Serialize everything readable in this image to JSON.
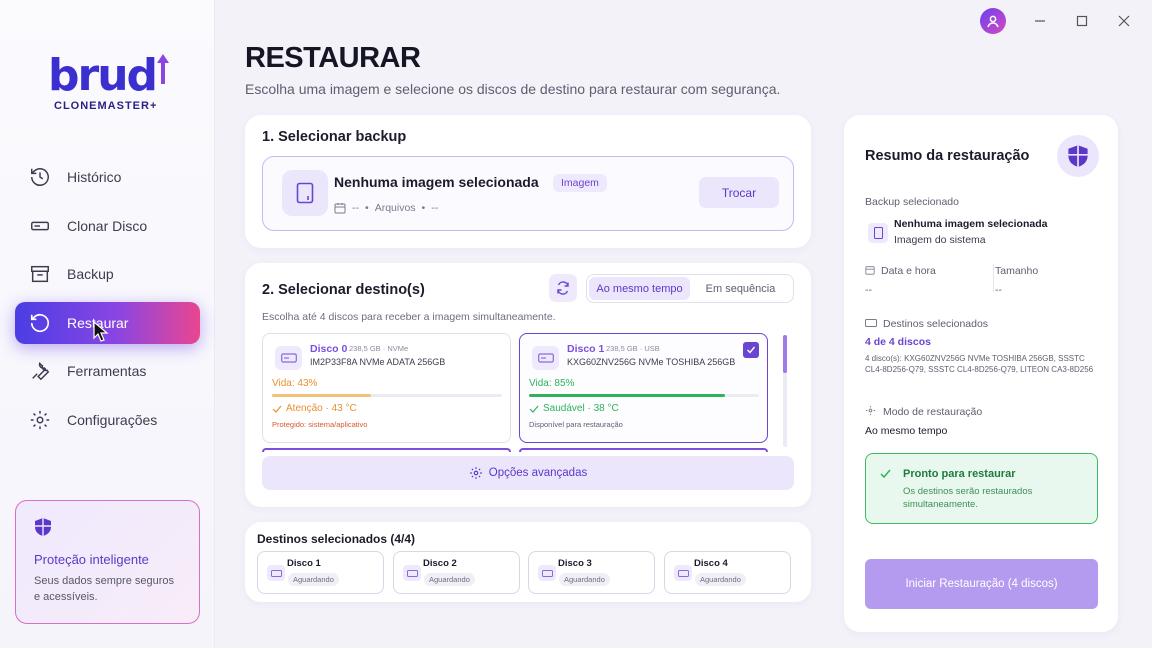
{
  "brand": {
    "logo_text": "brud",
    "tagline": "CLONEMASTER+"
  },
  "nav": {
    "items": [
      {
        "label": "Histórico"
      },
      {
        "label": "Clonar Disco"
      },
      {
        "label": "Backup"
      },
      {
        "label": "Restaurar"
      },
      {
        "label": "Ferramentas"
      },
      {
        "label": "Configurações"
      }
    ]
  },
  "promo": {
    "title": "Proteção inteligente",
    "text": "Seus dados sempre seguros e acessíveis."
  },
  "page": {
    "title": "RESTAURAR",
    "subtitle": "Escolha uma imagem e selecione os discos de destino para restaurar com segurança."
  },
  "step1": {
    "title": "1. Selecionar backup",
    "image_name": "Nenhuma imagem selecionada",
    "tag": "Imagem",
    "meta_date": "--",
    "meta_files": "Arquivos",
    "meta_size": "--",
    "change_button": "Trocar"
  },
  "step2": {
    "title": "2. Selecionar destino(s)",
    "mode_options": [
      "Ao mesmo tempo",
      "Em sequência"
    ],
    "hint": "Escolha até 4 discos para receber a imagem simultaneamente.",
    "disks": [
      {
        "name": "Disco 0",
        "spec": "238,5 GB · NVMe",
        "model": "IM2P33F8A NVMe ADATA 256GB",
        "life": "Vida: 43%",
        "life_pct": 43,
        "status": "Atenção · 43 °C",
        "note": "Protegido: sistema/aplicativo",
        "color": "#e8902e"
      },
      {
        "name": "Disco 1",
        "spec": "238,5 GB · USB",
        "model": "KXG60ZNV256G NVMe TOSHIBA 256GB",
        "life": "Vida: 85%",
        "life_pct": 85,
        "status": "Saudável · 38 °C",
        "note": "Disponível para restauração",
        "color": "#2fb35a"
      }
    ],
    "advanced": "Opções avançadas"
  },
  "destinations": {
    "title": "Destinos selecionados (4/4)",
    "items": [
      {
        "name": "Disco 1",
        "status": "Aguardando"
      },
      {
        "name": "Disco 2",
        "status": "Aguardando"
      },
      {
        "name": "Disco 3",
        "status": "Aguardando"
      },
      {
        "name": "Disco 4",
        "status": "Aguardando"
      }
    ]
  },
  "summary": {
    "title": "Resumo da restauração",
    "backup_label": "Backup selecionado",
    "backup_name": "Nenhuma imagem selecionada",
    "backup_type": "Imagem do sistema",
    "date_label": "Data e hora",
    "date_value": "--",
    "size_label": "Tamanho",
    "size_value": "--",
    "dest_label": "Destinos selecionados",
    "dest_count": "4 de 4 discos",
    "dest_list": "4 disco(s): KXG60ZNV256G NVMe TOSHIBA 256GB, SSSTC CL4-8D256-Q79, SSSTC CL4-8D256-Q79, LITEON CA3-8D256",
    "mode_label": "Modo de restauração",
    "mode_value": "Ao mesmo tempo",
    "ready_title": "Pronto para restaurar",
    "ready_text": "Os destinos serão restaurados simultaneamente.",
    "start_button": "Iniciar Restauração (4 discos)"
  },
  "colors": {
    "accent": "#6a45cf",
    "ok": "#2fb35a",
    "warn": "#e8902e"
  }
}
